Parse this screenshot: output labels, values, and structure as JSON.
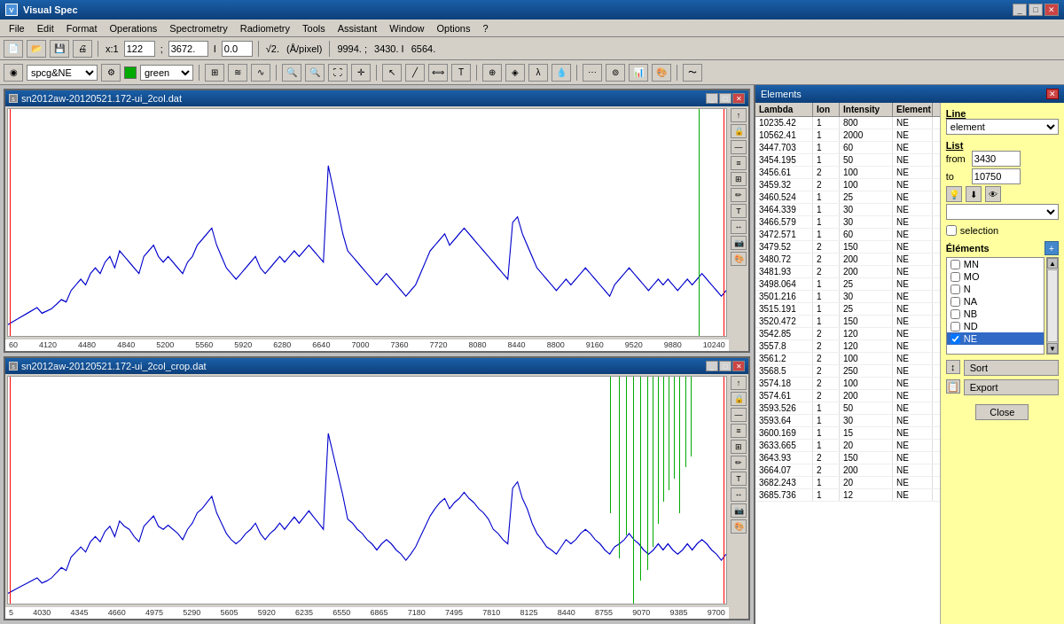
{
  "app": {
    "title": "Visual Spec",
    "title_icon": "VS"
  },
  "menu": {
    "items": [
      "File",
      "Edit",
      "Format",
      "Operations",
      "Spectrometry",
      "Radiometry",
      "Tools",
      "Assistant",
      "Window",
      "Options",
      "?"
    ]
  },
  "toolbar1": {
    "zoom_label": "x:1",
    "coord_x": "122",
    "coord_y": "3672.",
    "intensity": "0.0",
    "scale": "√2.",
    "unit": "(Å/pixel)",
    "pos1": "9994.",
    "pos2": "3430.",
    "pos3": "6564."
  },
  "toolbar2": {
    "profile_value": "spcg&NE",
    "color": "green"
  },
  "charts": [
    {
      "id": "chart1",
      "title": "sn2012aw-20120521.172-ui_2col.dat",
      "x_labels": [
        "60",
        "4120",
        "4480",
        "4840",
        "5200",
        "5560",
        "5920",
        "6280",
        "6640",
        "7000",
        "7360",
        "7720",
        "8080",
        "8440",
        "8800",
        "9160",
        "9520",
        "9880",
        "10240"
      ],
      "has_green_line": true
    },
    {
      "id": "chart2",
      "title": "sn2012aw-20120521.172-ui_2col_crop.dat",
      "x_labels": [
        "5",
        "4030",
        "4345",
        "4660",
        "4975",
        "5290",
        "5605",
        "5920",
        "6235",
        "6550",
        "6865",
        "7180",
        "7495",
        "7810",
        "8125",
        "8440",
        "8755",
        "9070",
        "9385",
        "9700"
      ],
      "has_green_line": true
    }
  ],
  "elements_panel": {
    "title": "Elements",
    "table_headers": [
      "Lambda",
      "Ion",
      "Intensity",
      "Element"
    ],
    "rows": [
      {
        "lambda": "10235.42",
        "ion": "1",
        "intensity": "800",
        "element": "NE"
      },
      {
        "lambda": "10562.41",
        "ion": "1",
        "intensity": "2000",
        "element": "NE"
      },
      {
        "lambda": "3447.703",
        "ion": "1",
        "intensity": "60",
        "element": "NE"
      },
      {
        "lambda": "3454.195",
        "ion": "1",
        "intensity": "50",
        "element": "NE"
      },
      {
        "lambda": "3456.61",
        "ion": "2",
        "intensity": "100",
        "element": "NE"
      },
      {
        "lambda": "3459.32",
        "ion": "2",
        "intensity": "100",
        "element": "NE"
      },
      {
        "lambda": "3460.524",
        "ion": "1",
        "intensity": "25",
        "element": "NE"
      },
      {
        "lambda": "3464.339",
        "ion": "1",
        "intensity": "30",
        "element": "NE"
      },
      {
        "lambda": "3466.579",
        "ion": "1",
        "intensity": "30",
        "element": "NE"
      },
      {
        "lambda": "3472.571",
        "ion": "1",
        "intensity": "60",
        "element": "NE"
      },
      {
        "lambda": "3479.52",
        "ion": "2",
        "intensity": "150",
        "element": "NE"
      },
      {
        "lambda": "3480.72",
        "ion": "2",
        "intensity": "200",
        "element": "NE"
      },
      {
        "lambda": "3481.93",
        "ion": "2",
        "intensity": "200",
        "element": "NE"
      },
      {
        "lambda": "3498.064",
        "ion": "1",
        "intensity": "25",
        "element": "NE"
      },
      {
        "lambda": "3501.216",
        "ion": "1",
        "intensity": "30",
        "element": "NE"
      },
      {
        "lambda": "3515.191",
        "ion": "1",
        "intensity": "25",
        "element": "NE"
      },
      {
        "lambda": "3520.472",
        "ion": "1",
        "intensity": "150",
        "element": "NE"
      },
      {
        "lambda": "3542.85",
        "ion": "2",
        "intensity": "120",
        "element": "NE"
      },
      {
        "lambda": "3557.8",
        "ion": "2",
        "intensity": "120",
        "element": "NE"
      },
      {
        "lambda": "3561.2",
        "ion": "2",
        "intensity": "100",
        "element": "NE"
      },
      {
        "lambda": "3568.5",
        "ion": "2",
        "intensity": "250",
        "element": "NE"
      },
      {
        "lambda": "3574.18",
        "ion": "2",
        "intensity": "100",
        "element": "NE"
      },
      {
        "lambda": "3574.61",
        "ion": "2",
        "intensity": "200",
        "element": "NE"
      },
      {
        "lambda": "3593.526",
        "ion": "1",
        "intensity": "50",
        "element": "NE"
      },
      {
        "lambda": "3593.64",
        "ion": "1",
        "intensity": "30",
        "element": "NE"
      },
      {
        "lambda": "3600.169",
        "ion": "1",
        "intensity": "15",
        "element": "NE"
      },
      {
        "lambda": "3633.665",
        "ion": "1",
        "intensity": "20",
        "element": "NE"
      },
      {
        "lambda": "3643.93",
        "ion": "2",
        "intensity": "150",
        "element": "NE"
      },
      {
        "lambda": "3664.07",
        "ion": "2",
        "intensity": "200",
        "element": "NE"
      },
      {
        "lambda": "3682.243",
        "ion": "1",
        "intensity": "20",
        "element": "NE"
      },
      {
        "lambda": "3685.736",
        "ion": "1",
        "intensity": "12",
        "element": "NE"
      }
    ],
    "line_label": "Line",
    "line_value": "element",
    "list_label": "List",
    "from_label": "from",
    "from_value": "3430",
    "to_label": "to",
    "to_value": "10750",
    "selection_label": "selection",
    "elements_section": "Éléments",
    "element_items": [
      {
        "name": "MN",
        "checked": false
      },
      {
        "name": "MO",
        "checked": false
      },
      {
        "name": "N",
        "checked": false
      },
      {
        "name": "NA",
        "checked": false
      },
      {
        "name": "NB",
        "checked": false
      },
      {
        "name": "ND",
        "checked": false
      },
      {
        "name": "NE",
        "checked": true
      }
    ],
    "sort_btn": "Sort",
    "export_btn": "Export",
    "close_btn": "Close"
  }
}
